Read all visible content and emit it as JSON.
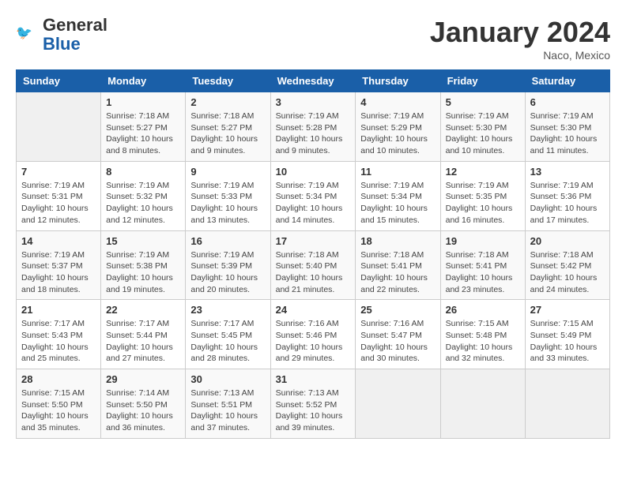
{
  "header": {
    "logo_general": "General",
    "logo_blue": "Blue",
    "month_title": "January 2024",
    "location": "Naco, Mexico"
  },
  "weekdays": [
    "Sunday",
    "Monday",
    "Tuesday",
    "Wednesday",
    "Thursday",
    "Friday",
    "Saturday"
  ],
  "weeks": [
    [
      {
        "day": "",
        "info": ""
      },
      {
        "day": "1",
        "info": "Sunrise: 7:18 AM\nSunset: 5:27 PM\nDaylight: 10 hours\nand 8 minutes."
      },
      {
        "day": "2",
        "info": "Sunrise: 7:18 AM\nSunset: 5:27 PM\nDaylight: 10 hours\nand 9 minutes."
      },
      {
        "day": "3",
        "info": "Sunrise: 7:19 AM\nSunset: 5:28 PM\nDaylight: 10 hours\nand 9 minutes."
      },
      {
        "day": "4",
        "info": "Sunrise: 7:19 AM\nSunset: 5:29 PM\nDaylight: 10 hours\nand 10 minutes."
      },
      {
        "day": "5",
        "info": "Sunrise: 7:19 AM\nSunset: 5:30 PM\nDaylight: 10 hours\nand 10 minutes."
      },
      {
        "day": "6",
        "info": "Sunrise: 7:19 AM\nSunset: 5:30 PM\nDaylight: 10 hours\nand 11 minutes."
      }
    ],
    [
      {
        "day": "7",
        "info": "Sunrise: 7:19 AM\nSunset: 5:31 PM\nDaylight: 10 hours\nand 12 minutes."
      },
      {
        "day": "8",
        "info": "Sunrise: 7:19 AM\nSunset: 5:32 PM\nDaylight: 10 hours\nand 12 minutes."
      },
      {
        "day": "9",
        "info": "Sunrise: 7:19 AM\nSunset: 5:33 PM\nDaylight: 10 hours\nand 13 minutes."
      },
      {
        "day": "10",
        "info": "Sunrise: 7:19 AM\nSunset: 5:34 PM\nDaylight: 10 hours\nand 14 minutes."
      },
      {
        "day": "11",
        "info": "Sunrise: 7:19 AM\nSunset: 5:34 PM\nDaylight: 10 hours\nand 15 minutes."
      },
      {
        "day": "12",
        "info": "Sunrise: 7:19 AM\nSunset: 5:35 PM\nDaylight: 10 hours\nand 16 minutes."
      },
      {
        "day": "13",
        "info": "Sunrise: 7:19 AM\nSunset: 5:36 PM\nDaylight: 10 hours\nand 17 minutes."
      }
    ],
    [
      {
        "day": "14",
        "info": "Sunrise: 7:19 AM\nSunset: 5:37 PM\nDaylight: 10 hours\nand 18 minutes."
      },
      {
        "day": "15",
        "info": "Sunrise: 7:19 AM\nSunset: 5:38 PM\nDaylight: 10 hours\nand 19 minutes."
      },
      {
        "day": "16",
        "info": "Sunrise: 7:19 AM\nSunset: 5:39 PM\nDaylight: 10 hours\nand 20 minutes."
      },
      {
        "day": "17",
        "info": "Sunrise: 7:18 AM\nSunset: 5:40 PM\nDaylight: 10 hours\nand 21 minutes."
      },
      {
        "day": "18",
        "info": "Sunrise: 7:18 AM\nSunset: 5:41 PM\nDaylight: 10 hours\nand 22 minutes."
      },
      {
        "day": "19",
        "info": "Sunrise: 7:18 AM\nSunset: 5:41 PM\nDaylight: 10 hours\nand 23 minutes."
      },
      {
        "day": "20",
        "info": "Sunrise: 7:18 AM\nSunset: 5:42 PM\nDaylight: 10 hours\nand 24 minutes."
      }
    ],
    [
      {
        "day": "21",
        "info": "Sunrise: 7:17 AM\nSunset: 5:43 PM\nDaylight: 10 hours\nand 25 minutes."
      },
      {
        "day": "22",
        "info": "Sunrise: 7:17 AM\nSunset: 5:44 PM\nDaylight: 10 hours\nand 27 minutes."
      },
      {
        "day": "23",
        "info": "Sunrise: 7:17 AM\nSunset: 5:45 PM\nDaylight: 10 hours\nand 28 minutes."
      },
      {
        "day": "24",
        "info": "Sunrise: 7:16 AM\nSunset: 5:46 PM\nDaylight: 10 hours\nand 29 minutes."
      },
      {
        "day": "25",
        "info": "Sunrise: 7:16 AM\nSunset: 5:47 PM\nDaylight: 10 hours\nand 30 minutes."
      },
      {
        "day": "26",
        "info": "Sunrise: 7:15 AM\nSunset: 5:48 PM\nDaylight: 10 hours\nand 32 minutes."
      },
      {
        "day": "27",
        "info": "Sunrise: 7:15 AM\nSunset: 5:49 PM\nDaylight: 10 hours\nand 33 minutes."
      }
    ],
    [
      {
        "day": "28",
        "info": "Sunrise: 7:15 AM\nSunset: 5:50 PM\nDaylight: 10 hours\nand 35 minutes."
      },
      {
        "day": "29",
        "info": "Sunrise: 7:14 AM\nSunset: 5:50 PM\nDaylight: 10 hours\nand 36 minutes."
      },
      {
        "day": "30",
        "info": "Sunrise: 7:13 AM\nSunset: 5:51 PM\nDaylight: 10 hours\nand 37 minutes."
      },
      {
        "day": "31",
        "info": "Sunrise: 7:13 AM\nSunset: 5:52 PM\nDaylight: 10 hours\nand 39 minutes."
      },
      {
        "day": "",
        "info": ""
      },
      {
        "day": "",
        "info": ""
      },
      {
        "day": "",
        "info": ""
      }
    ]
  ]
}
